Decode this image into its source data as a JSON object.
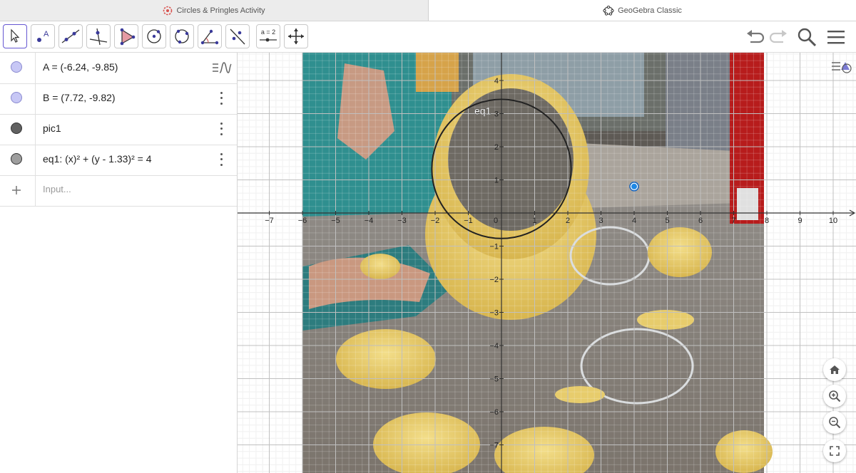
{
  "tabs": {
    "left": "Circles & Pringles Activity",
    "right": "GeoGebra Classic"
  },
  "toolbar": {
    "slider_tool_label": "a = 2"
  },
  "algebra": {
    "rows": [
      {
        "text": "A = (-6.24, -9.85)",
        "color": "#c7c7f5"
      },
      {
        "text": "B = (7.72, -9.82)",
        "color": "#c7c7f5"
      },
      {
        "text": "pic1",
        "color": "#616161"
      },
      {
        "text": "eq1: (x)² + (y - 1.33)² = 4",
        "color": "#9e9e9e"
      }
    ],
    "input_placeholder": "Input..."
  },
  "graphics": {
    "curve_label": "eq1",
    "x_ticks": [
      "-7",
      "-6",
      "-5",
      "-4",
      "-3",
      "-2",
      "-1",
      "0",
      "1",
      "2",
      "3",
      "4",
      "5",
      "6",
      "7",
      "8",
      "9",
      "10"
    ],
    "y_ticks": [
      "4",
      "3",
      "2",
      "1",
      "-1",
      "-2",
      "-3",
      "-4",
      "-5",
      "-6",
      "-7"
    ],
    "circle": {
      "center_x": 0,
      "center_y": 1.33,
      "radius": 2
    },
    "point": {
      "x": 4.0,
      "y": 0.8
    }
  }
}
